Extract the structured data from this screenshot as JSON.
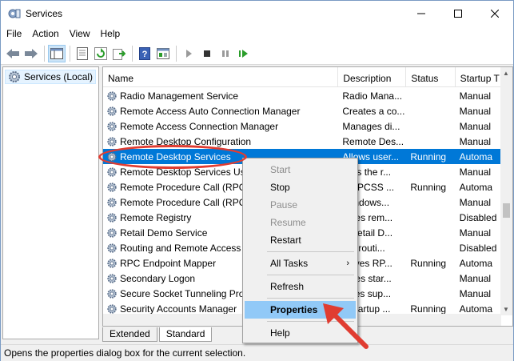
{
  "window": {
    "title": "Services"
  },
  "menubar": [
    "File",
    "Action",
    "View",
    "Help"
  ],
  "tree": {
    "root_label": "Services (Local)"
  },
  "columns": {
    "name": "Name",
    "description": "Description",
    "status": "Status",
    "startup": "Startup T"
  },
  "services": [
    {
      "name": "Radio Management Service",
      "description": "Radio Mana...",
      "status": "",
      "startup": "Manual"
    },
    {
      "name": "Remote Access Auto Connection Manager",
      "description": "Creates a co...",
      "status": "",
      "startup": "Manual"
    },
    {
      "name": "Remote Access Connection Manager",
      "description": "Manages di...",
      "status": "",
      "startup": "Manual"
    },
    {
      "name": "Remote Desktop Configuration",
      "description": "Remote Des...",
      "status": "",
      "startup": "Manual"
    },
    {
      "name": "Remote Desktop Services",
      "description": "Allows user...",
      "status": "Running",
      "startup": "Automa",
      "selected": true
    },
    {
      "name": "Remote Desktop Services Use",
      "description": "lows the r...",
      "status": "",
      "startup": "Manual"
    },
    {
      "name": "Remote Procedure Call (RPC",
      "description": "e RPCSS ...",
      "status": "Running",
      "startup": "Automa"
    },
    {
      "name": "Remote Procedure Call (RPC",
      "description": "Windows...",
      "status": "",
      "startup": "Manual"
    },
    {
      "name": "Remote Registry",
      "description": "ables rem...",
      "status": "",
      "startup": "Disabled"
    },
    {
      "name": "Retail Demo Service",
      "description": "e Retail D...",
      "status": "",
      "startup": "Manual"
    },
    {
      "name": "Routing and Remote Access",
      "description": "ers routi...",
      "status": "",
      "startup": "Disabled"
    },
    {
      "name": "RPC Endpoint Mapper",
      "description": "solves RP...",
      "status": "Running",
      "startup": "Automa"
    },
    {
      "name": "Secondary Logon",
      "description": "ables star...",
      "status": "",
      "startup": "Manual"
    },
    {
      "name": "Secure Socket Tunneling Pro",
      "description": "vides sup...",
      "status": "",
      "startup": "Manual"
    },
    {
      "name": "Security Accounts Manager",
      "description": "e startup ...",
      "status": "Running",
      "startup": "Automa"
    }
  ],
  "tabs": [
    "Extended",
    "Standard"
  ],
  "statusbar": {
    "text": "Opens the properties dialog box for the current selection."
  },
  "context_menu": {
    "items": [
      {
        "label": "Start",
        "disabled": true
      },
      {
        "label": "Stop",
        "disabled": false
      },
      {
        "label": "Pause",
        "disabled": true
      },
      {
        "label": "Resume",
        "disabled": true
      },
      {
        "label": "Restart",
        "disabled": false
      },
      {
        "label": "All Tasks",
        "disabled": false,
        "submenu": true
      },
      {
        "label": "Refresh",
        "disabled": false
      },
      {
        "label": "Properties",
        "disabled": false,
        "highlighted": true
      },
      {
        "label": "Help",
        "disabled": false
      }
    ],
    "submenu_glyph": "›"
  },
  "colors": {
    "selection": "#0078d7",
    "menu_highlight": "#91c9f7",
    "annotation": "#e03c31"
  },
  "icons": [
    "services-app-icon",
    "back-arrow-icon",
    "forward-arrow-icon",
    "console-tree-icon",
    "properties-sheet-icon",
    "refresh-icon",
    "export-list-icon",
    "help-icon",
    "mmc-icon",
    "play-icon",
    "stop-icon",
    "pause-icon",
    "restart-icon",
    "gear-icon"
  ]
}
